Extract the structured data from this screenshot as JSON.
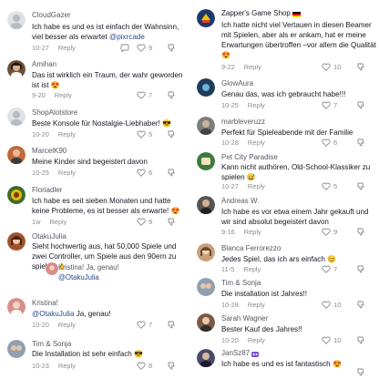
{
  "left": [
    {
      "user": "CloudGazer",
      "text": "Ich habe es und es ist einfach der Wahnsinn, viel besser als erwartet",
      "mention": "@pixrcade",
      "date": "10-27",
      "reply": "Reply",
      "likes": "9",
      "avatar_color": "#dfe3e8"
    },
    {
      "user": "Amihan",
      "text": "Das ist wirklich ein Traum, der wahr geworden ist ist",
      "emoji": "😍",
      "date": "9-20",
      "reply": "Reply",
      "likes": "7",
      "avatar_color": "#6b4f3a"
    },
    {
      "user": "ShopAlotstore",
      "text": "Beste Konsole für Nostalgie-Liebhaber!",
      "emoji": "😎",
      "date": "10-20",
      "reply": "Reply",
      "likes": "5",
      "avatar_color": "#dfe3e8"
    },
    {
      "user": "MarcelK90",
      "text": "Meine Kinder sind begeistert davon",
      "date": "10-25",
      "reply": "Reply",
      "likes": "6",
      "avatar_color": "#c06a3c"
    },
    {
      "user": "Floriadler",
      "text": "Ich habe es seit sieben Monaten und hatte keine Probleme, es ist besser als erwarte!",
      "emoji": "😍",
      "date": "1w",
      "reply": "Reply",
      "likes": "9",
      "avatar_color": "#e6b800"
    },
    {
      "user": "OtakuJulia",
      "text": "Sieht hochwertig aus, hat 50,000 Spiele und zwei Controller, um Spiele aus den 90ern zu spielen",
      "emoji": "👌",
      "sub_user": "Kristina! Ja, genau!",
      "sub_mention": "@OtakuJulia",
      "avatar_color": "#a0522d",
      "sub_avatar_color": "#d98c8c"
    },
    {
      "user": "Kristina!",
      "mention": "@OtakuJulia",
      "text": "Ja, genau!",
      "date": "10-20",
      "reply": "Reply",
      "likes": "7",
      "avatar_color": "#d98c8c"
    },
    {
      "user": "Tim & Sonja",
      "text": "Die Installation ist sehr einfach",
      "emoji": "😎",
      "date": "10-23",
      "reply": "Reply",
      "likes": "8",
      "avatar_color": "#8fa0b0"
    }
  ],
  "right": [
    {
      "user": "Zapper's Game Shop",
      "text": "Ich hatte nicht viel Vertauen in diesen Beamer mit Spielen, aber als er ankam, hat er meine Erwartungen übertroffen –vor allem die Qualität",
      "emoji": "😍",
      "date": "9-22",
      "reply": "Reply",
      "likes": "10",
      "avatar_color": "#1d3a6b"
    },
    {
      "user": "GlowAura",
      "text": "Genau das, was ich gebraucht habe!!!",
      "date": "10-25",
      "reply": "Reply",
      "likes": "7",
      "avatar_color": "#1f3c5a"
    },
    {
      "user": "marbleveruzz",
      "text": "Perfekt für Spieleabende mit der Familie",
      "date": "10-28",
      "reply": "Reply",
      "likes": "6",
      "avatar_color": "#7d7d7d"
    },
    {
      "user": "Pet City Paradise",
      "text": "Kann nicht authören, Old-School-Klassiker zu spielen",
      "emoji": "😅",
      "date": "10-27",
      "reply": "Reply",
      "likes": "5",
      "avatar_color": "#3d7a3d"
    },
    {
      "user": "Andreas W.",
      "text": "Ich habe es vor etwa einem Jahr gekauft und wir sind absolut begeistert davon",
      "date": "9-16",
      "reply": "Reply",
      "likes": "9",
      "avatar_color": "#555555"
    },
    {
      "user": "Blanca Ferrorezzo",
      "text": "Jedes Spiel, das ich ars einfach",
      "emoji": "😊",
      "date": "11-5",
      "reply": "Reply",
      "likes": "7",
      "avatar_color": "#c9a07a"
    },
    {
      "user": "Tim & Sonja",
      "text": "Die installation ist Jahres!!",
      "date": "10-28",
      "reply": "Reply",
      "likes": "10",
      "avatar_color": "#8fa0b0"
    },
    {
      "user": "Sarah Wagner",
      "text": "Bester Kauf des Jahres!!",
      "date": "10-20",
      "reply": "Reply",
      "likes": "10",
      "avatar_color": "#7a5a44"
    },
    {
      "user": "JanSz87",
      "text": "Ich habe es und es ist fantastisch",
      "emoji": "😍",
      "date": "",
      "reply": "",
      "likes": "",
      "avatar_color": "#4a4a6a"
    }
  ],
  "icons": {
    "heart": "heart-icon",
    "reply": "reply-icon",
    "dislike": "dislike-icon"
  },
  "colors": {
    "username": "#555a63",
    "text": "#161823",
    "meta": "#8a8b91",
    "mention": "#2b4a8f"
  }
}
